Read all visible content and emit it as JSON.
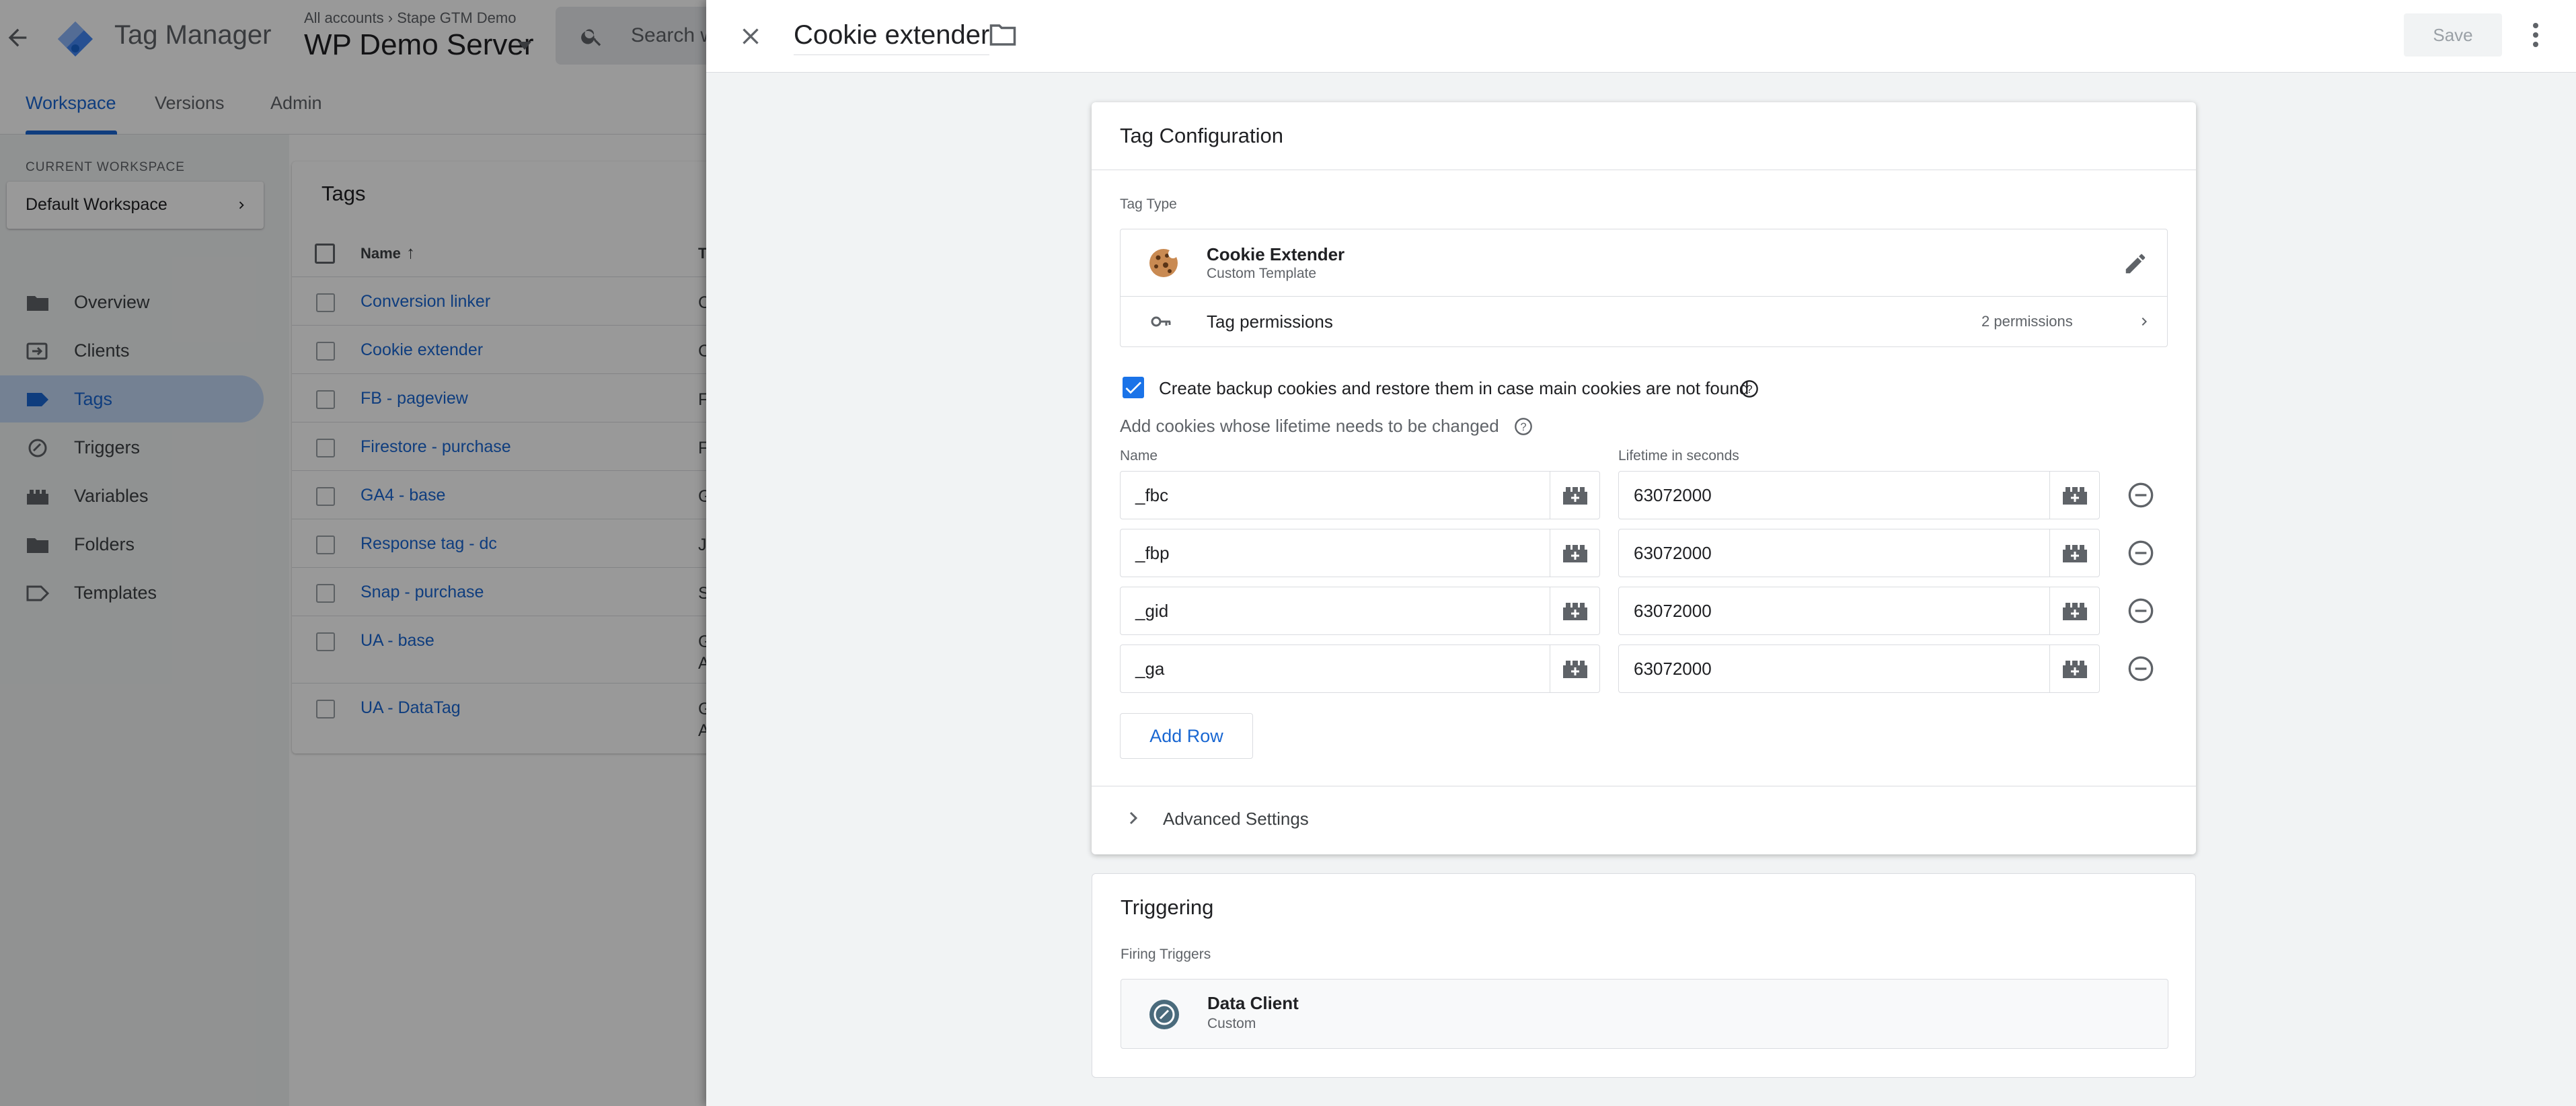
{
  "app": {
    "name": "Tag Manager",
    "breadcrumb": [
      "All accounts",
      "Stape GTM Demo"
    ],
    "container": "WP Demo Server",
    "search_placeholder": "Search w"
  },
  "workspace_tabs": [
    "Workspace",
    "Versions",
    "Admin"
  ],
  "sidebar": {
    "current_workspace_label": "CURRENT WORKSPACE",
    "workspace_name": "Default Workspace",
    "items": [
      {
        "label": "Overview",
        "icon": "folder-icon"
      },
      {
        "label": "Clients",
        "icon": "clients-icon"
      },
      {
        "label": "Tags",
        "icon": "tag-icon",
        "active": true
      },
      {
        "label": "Triggers",
        "icon": "trigger-icon"
      },
      {
        "label": "Variables",
        "icon": "variables-icon"
      },
      {
        "label": "Folders",
        "icon": "folder-icon"
      },
      {
        "label": "Templates",
        "icon": "template-icon"
      }
    ]
  },
  "tags_list": {
    "title": "Tags",
    "header_name": "Name",
    "header_type": "T",
    "rows": [
      {
        "name": "Conversion linker",
        "type": "C"
      },
      {
        "name": "Cookie extender",
        "type": "C"
      },
      {
        "name": "FB - pageview",
        "type": "F"
      },
      {
        "name": "Firestore - purchase",
        "type": "F"
      },
      {
        "name": "GA4 - base",
        "type": "G"
      },
      {
        "name": "Response tag - dc",
        "type": "J"
      },
      {
        "name": "Snap - purchase",
        "type": "S"
      },
      {
        "name": "UA - base",
        "type": "G",
        "type2": "A"
      },
      {
        "name": "UA - DataTag",
        "type": "G",
        "type2": "A"
      }
    ]
  },
  "editor": {
    "title": "Cookie extender",
    "save_label": "Save",
    "config": {
      "title": "Tag Configuration",
      "tag_type_label": "Tag Type",
      "tag_type_name": "Cookie Extender",
      "tag_type_sub": "Custom Template",
      "permissions_label": "Tag permissions",
      "permissions_count": "2 permissions",
      "backup_checked": true,
      "backup_label": "Create backup cookies and restore them in case main cookies are not found",
      "cookies_label": "Add cookies whose lifetime needs to be changed",
      "col_name": "Name",
      "col_lifetime": "Lifetime in seconds",
      "rows": [
        {
          "name": "_fbc",
          "lifetime": "63072000"
        },
        {
          "name": "_fbp",
          "lifetime": "63072000"
        },
        {
          "name": "_gid",
          "lifetime": "63072000"
        },
        {
          "name": "_ga",
          "lifetime": "63072000"
        }
      ],
      "add_row_label": "Add Row",
      "advanced_label": "Advanced Settings"
    },
    "triggering": {
      "title": "Triggering",
      "firing_label": "Firing Triggers",
      "trigger_name": "Data Client",
      "trigger_sub": "Custom"
    }
  },
  "colors": {
    "accent": "#1967d2",
    "checkbox": "#1a73e8",
    "active_nav": "#c2d7f5"
  }
}
